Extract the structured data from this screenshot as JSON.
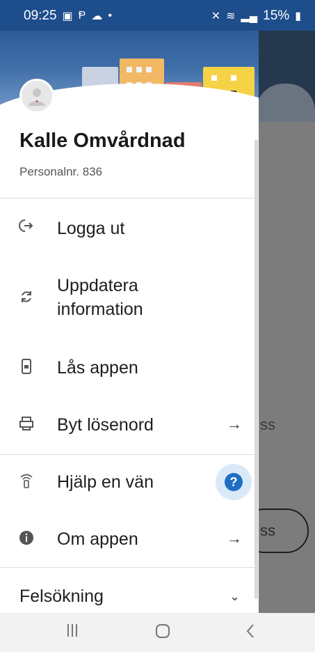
{
  "status": {
    "time": "09:25",
    "battery": "15%"
  },
  "drawer": {
    "user_name": "Kalle Omvårdnad",
    "user_id": "Personalnr. 836",
    "items": [
      {
        "label": "Logga ut",
        "icon": "logout-icon"
      },
      {
        "label_line1": "Uppdatera",
        "label_line2": "information",
        "icon": "refresh-icon"
      },
      {
        "label": "Lås appen",
        "icon": "lock-phone-icon"
      },
      {
        "label": "Byt lösenord",
        "icon": "keyboard-icon",
        "arrow": "→"
      },
      {
        "label": "Hjälp en vän",
        "icon": "wifi-phone-icon",
        "help": "?"
      },
      {
        "label": "Om appen",
        "icon": "info-icon",
        "arrow": "→"
      }
    ],
    "trouble_label": "Felsökning",
    "trouble_chevron": "⌄"
  },
  "background": {
    "text1": "ss",
    "text2": "ss"
  },
  "colors": {
    "status_bar": "#1e4d8b",
    "help_blue": "#1e6fc4"
  }
}
